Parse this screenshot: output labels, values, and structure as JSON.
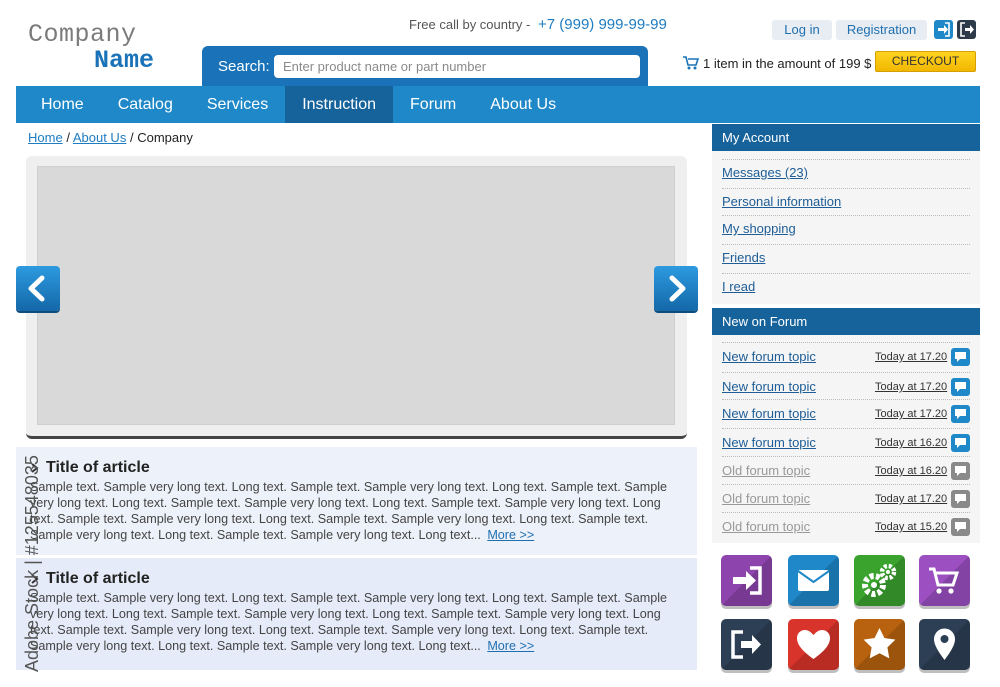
{
  "header": {
    "logo_line1": "Company",
    "logo_line2": "Name",
    "phone_label": "Free call by country -",
    "phone_number": "+7 (999) 999-99-99",
    "search_label": "Search:",
    "search_placeholder": "Enter product name or part number",
    "login_label": "Log in",
    "register_label": "Registration",
    "cart_text": "1 item in the amount of 199 $",
    "checkout_label": "CHECKOUT"
  },
  "nav": {
    "items": [
      "Home",
      "Catalog",
      "Services",
      "Instruction",
      "Forum",
      "About Us"
    ],
    "active": "Instruction"
  },
  "breadcrumb": {
    "home": "Home",
    "about": "About Us",
    "current": "Company",
    "separator": "/"
  },
  "articles": [
    {
      "title": "Title of article",
      "text": "Sample text. Sample very long text. Long text. Sample text. Sample very long text. Long text. Sample text. Sample very long text. Long text. Sample text. Sample very long text. Long text. Sample text. Sample very long text. Long text. Sample text. Sample very long text. Long text. Sample text. Sample very long text. Long text. Sample text. Sample very long text. Long text. Sample text. Sample very long text. Long text...",
      "more": "More >>"
    },
    {
      "title": "Title of article",
      "text": "Sample text. Sample very long text. Long text. Sample text. Sample very long text. Long text. Sample text. Sample very long text. Long text. Sample text. Sample very long text. Long text. Sample text. Sample very long text. Long text. Sample text. Sample very long text. Long text. Sample text. Sample very long text. Long text. Sample text. Sample very long text. Long text. Sample text. Sample very long text. Long text...",
      "more": "More >>"
    }
  ],
  "account": {
    "title": "My Account",
    "items": [
      "Messages (23)",
      "Personal information",
      "My shopping",
      "Friends",
      "I read"
    ]
  },
  "forum": {
    "title": "New on Forum",
    "rows": [
      {
        "topic": "New forum topic",
        "time": "Today at 17.20",
        "status": "new"
      },
      {
        "topic": "New forum topic",
        "time": "Today at 17.20",
        "status": "new"
      },
      {
        "topic": "New forum topic",
        "time": "Today at 17.20",
        "status": "new"
      },
      {
        "topic": "New forum topic",
        "time": "Today at 16.20",
        "status": "new"
      },
      {
        "topic": "Old forum topic",
        "time": "Today at 16.20",
        "status": "old"
      },
      {
        "topic": "Old forum topic",
        "time": "Today at 17.20",
        "status": "old"
      },
      {
        "topic": "Old forum topic",
        "time": "Today at 15.20",
        "status": "old"
      }
    ]
  },
  "tiles": [
    {
      "name": "login-tile-icon",
      "color": "#8e44ad"
    },
    {
      "name": "mail-tile-icon",
      "color": "#1e88c8"
    },
    {
      "name": "settings-tile-icon",
      "color": "#3aa32e"
    },
    {
      "name": "cart-tile-icon",
      "color": "#9b4fc1"
    },
    {
      "name": "logout-tile-icon",
      "color": "#2d3f55"
    },
    {
      "name": "heart-tile-icon",
      "color": "#d9342b"
    },
    {
      "name": "star-tile-icon",
      "color": "#b8620f"
    },
    {
      "name": "location-tile-icon",
      "color": "#2d3f55"
    }
  ],
  "watermark": "Adobe Stock | #125548035",
  "colors": {
    "primary": "#1e88c8",
    "dark_primary": "#16639c",
    "checkout": "#f2b700"
  }
}
